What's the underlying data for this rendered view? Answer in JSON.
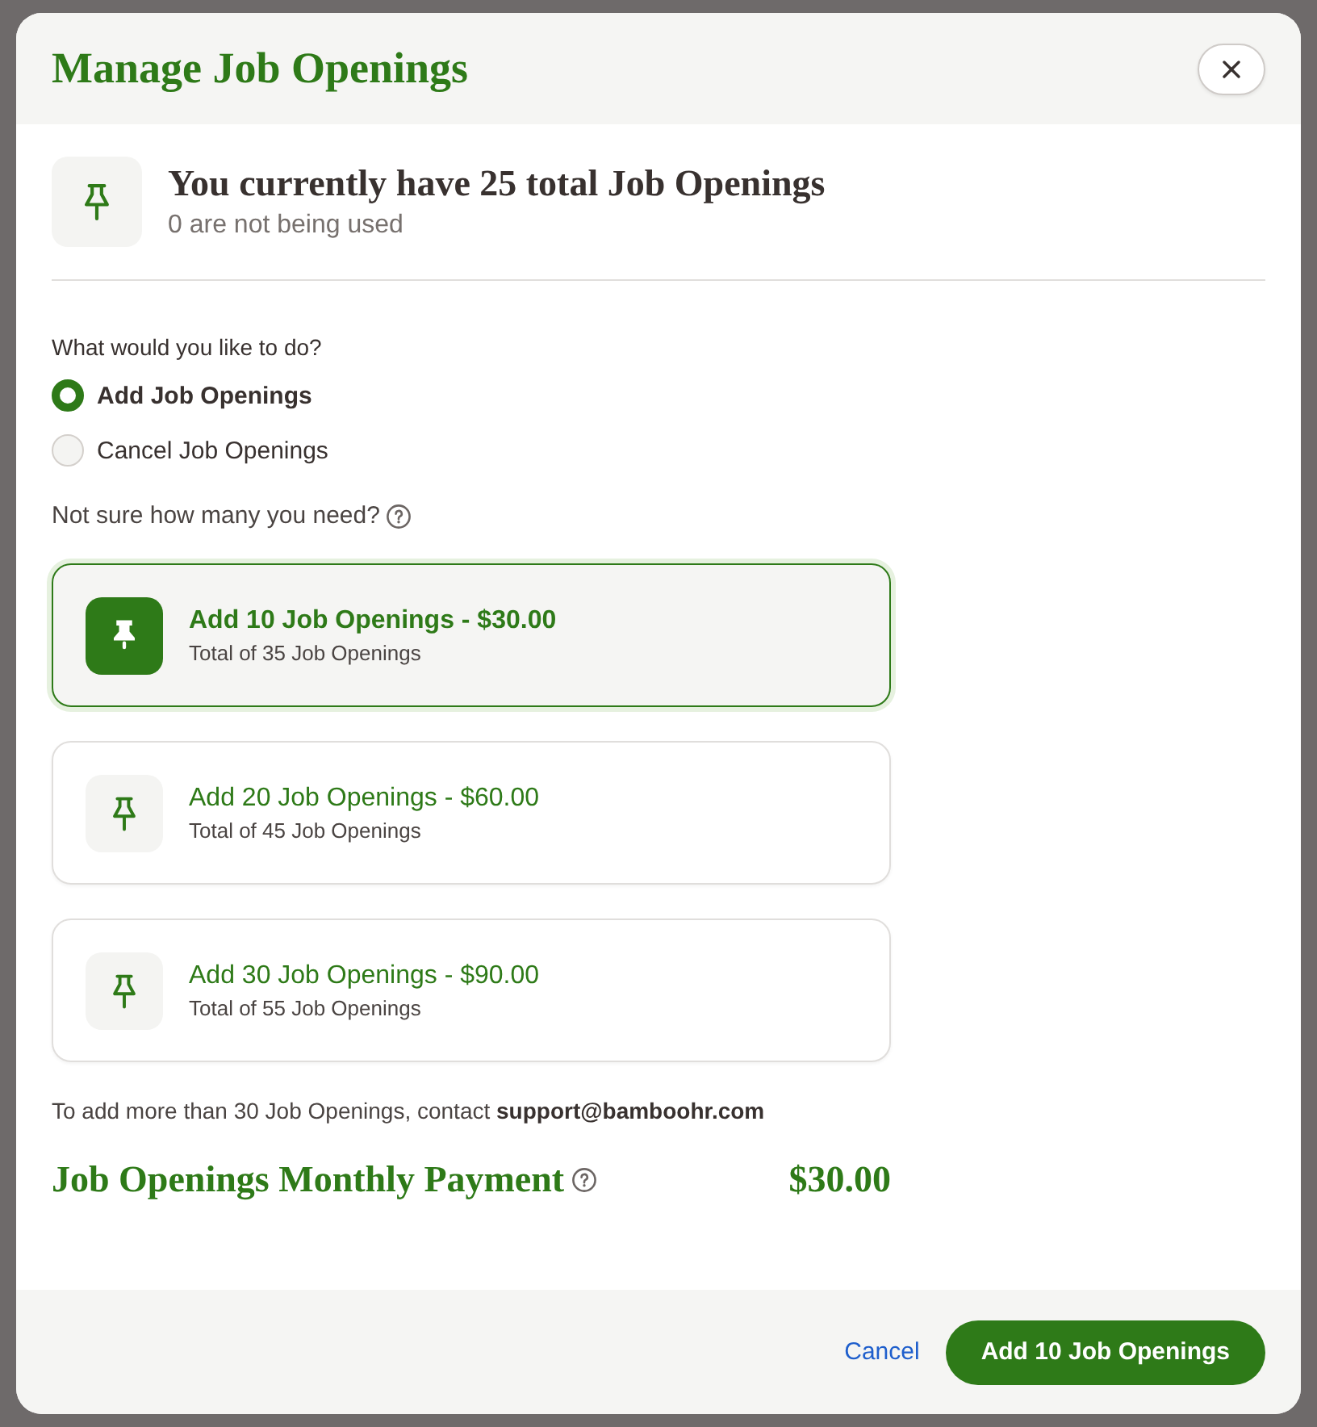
{
  "dialog": {
    "title": "Manage Job Openings"
  },
  "summary": {
    "heading": "You currently have 25 total Job Openings",
    "subtext": "0 are not being used"
  },
  "question": "What would you like to do?",
  "actions": [
    {
      "label": "Add Job Openings",
      "selected": true
    },
    {
      "label": "Cancel Job Openings",
      "selected": false
    }
  ],
  "help_prompt": "Not sure how many you need?",
  "packages": [
    {
      "title": "Add 10 Job Openings - $30.00",
      "subtitle": "Total of 35 Job Openings",
      "selected": true
    },
    {
      "title": "Add 20 Job Openings - $60.00",
      "subtitle": "Total of 45 Job Openings",
      "selected": false
    },
    {
      "title": "Add 30 Job Openings - $90.00",
      "subtitle": "Total of 55 Job Openings",
      "selected": false
    }
  ],
  "contact_note": "To add more than 30 Job Openings, contact **support@bamboohr.com**",
  "payment": {
    "label": "Job Openings Monthly Payment",
    "amount": "$30.00"
  },
  "footer": {
    "buttons": [
      {
        "label": "Cancel",
        "kind": "link"
      },
      {
        "label": "Add 10 Job Openings",
        "kind": "primary"
      }
    ]
  }
}
